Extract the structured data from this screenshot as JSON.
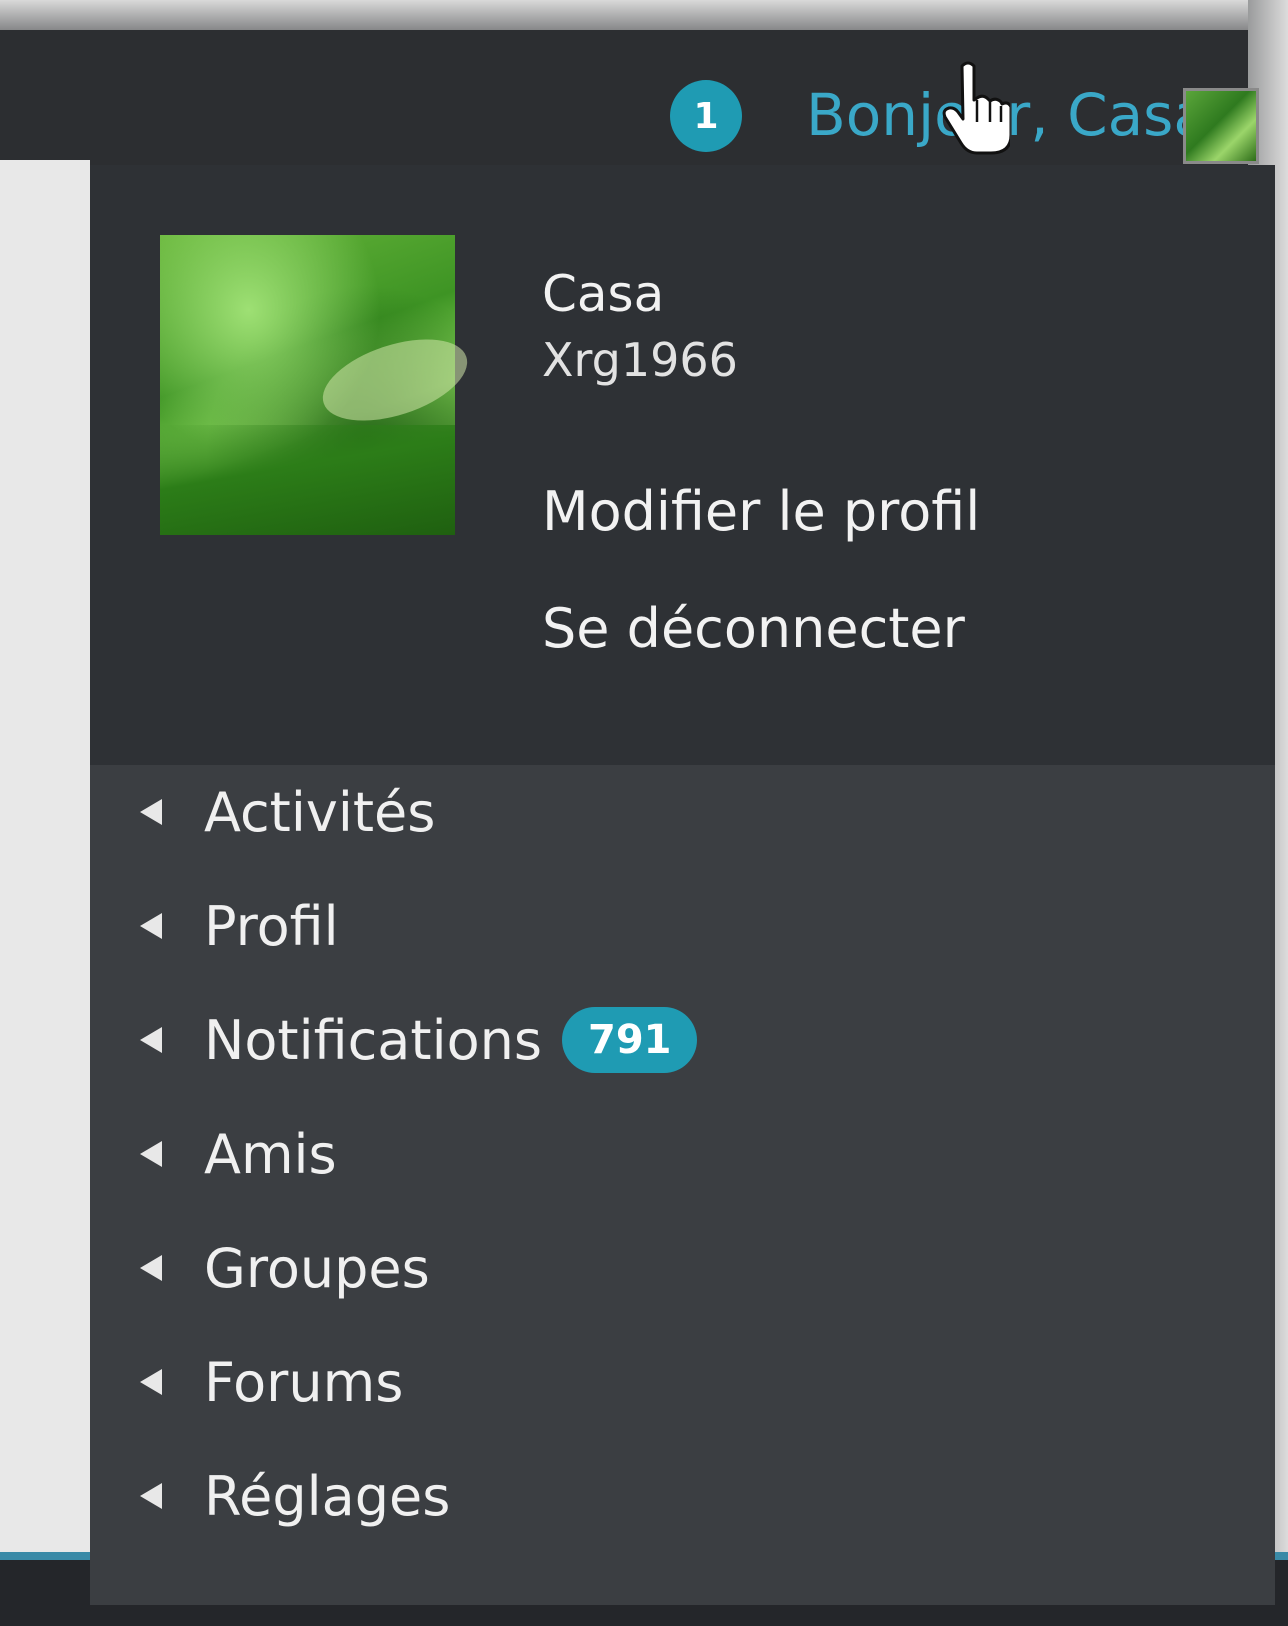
{
  "header": {
    "notification_count": "1",
    "greeting": "Bonjour, Casa"
  },
  "profile": {
    "display_name": "Casa",
    "username": "Xrg1966",
    "links": [
      "Modifier le profil",
      "Se déconnecter"
    ]
  },
  "menu": {
    "items": [
      {
        "label": "Activités"
      },
      {
        "label": "Profil"
      },
      {
        "label": "Notifications",
        "badge": "791"
      },
      {
        "label": "Amis"
      },
      {
        "label": "Groupes"
      },
      {
        "label": "Forums"
      },
      {
        "label": "Réglages"
      }
    ]
  },
  "colors": {
    "accent": "#1f9bb3",
    "link": "#3aa8c8",
    "panel": "#3b3e42",
    "profile_box": "#2e3135"
  }
}
